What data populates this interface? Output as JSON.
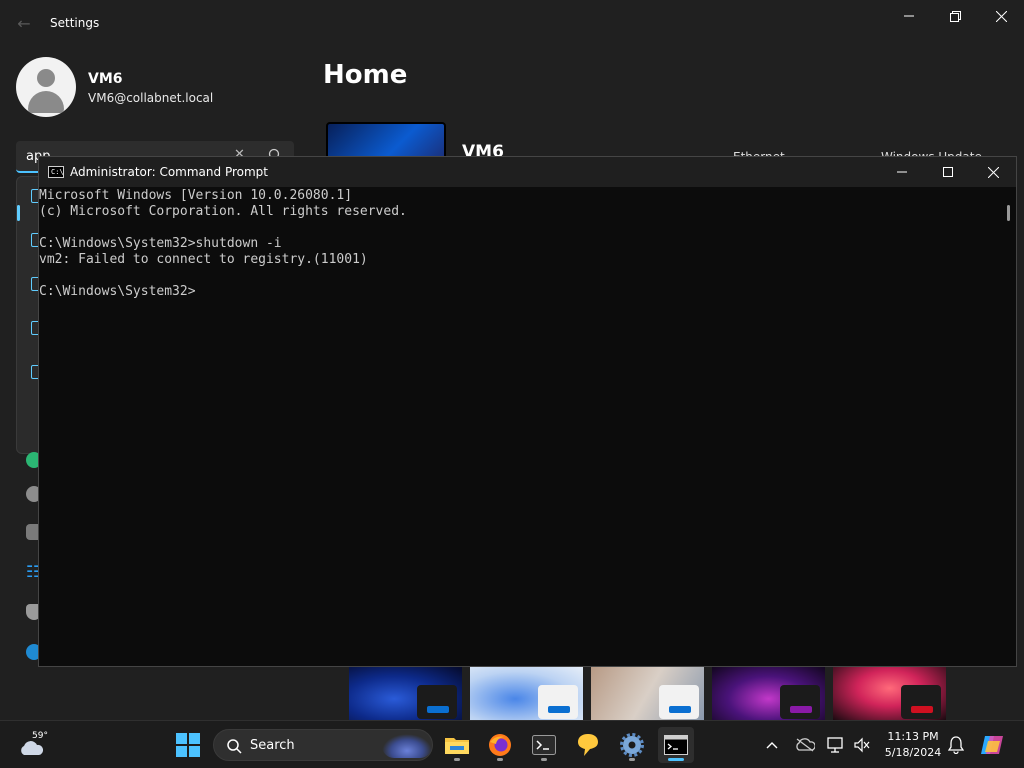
{
  "settings": {
    "app_title": "Settings",
    "user": {
      "name": "VM6",
      "email": "VM6@collabnet.local"
    },
    "search": {
      "value": "app"
    },
    "page_title": "Home",
    "device": {
      "name": "VM6"
    },
    "headers": {
      "ethernet": "Ethernet",
      "windows_update": "Windows Update"
    }
  },
  "cmd": {
    "title": "Administrator: Command Prompt",
    "icon_text": "C:\\",
    "lines": [
      "Microsoft Windows [Version 10.0.26080.1]",
      "(c) Microsoft Corporation. All rights reserved.",
      "",
      "C:\\Windows\\System32>shutdown -i",
      "vm2: Failed to connect to registry.(11001)",
      "",
      "C:\\Windows\\System32>"
    ]
  },
  "taskbar": {
    "weather_temp": "59°",
    "search_label": "Search",
    "clock_time": "11:13 PM",
    "clock_date": "5/18/2024",
    "apps": [
      "start",
      "search",
      "file-explorer",
      "firefox",
      "terminal",
      "feedback-hub",
      "settings",
      "command-prompt"
    ]
  },
  "colors": {
    "accent": "#4cc2ff",
    "console_bg": "#0c0c0c",
    "console_text": "#cccccc",
    "settings_bg": "#202020"
  }
}
